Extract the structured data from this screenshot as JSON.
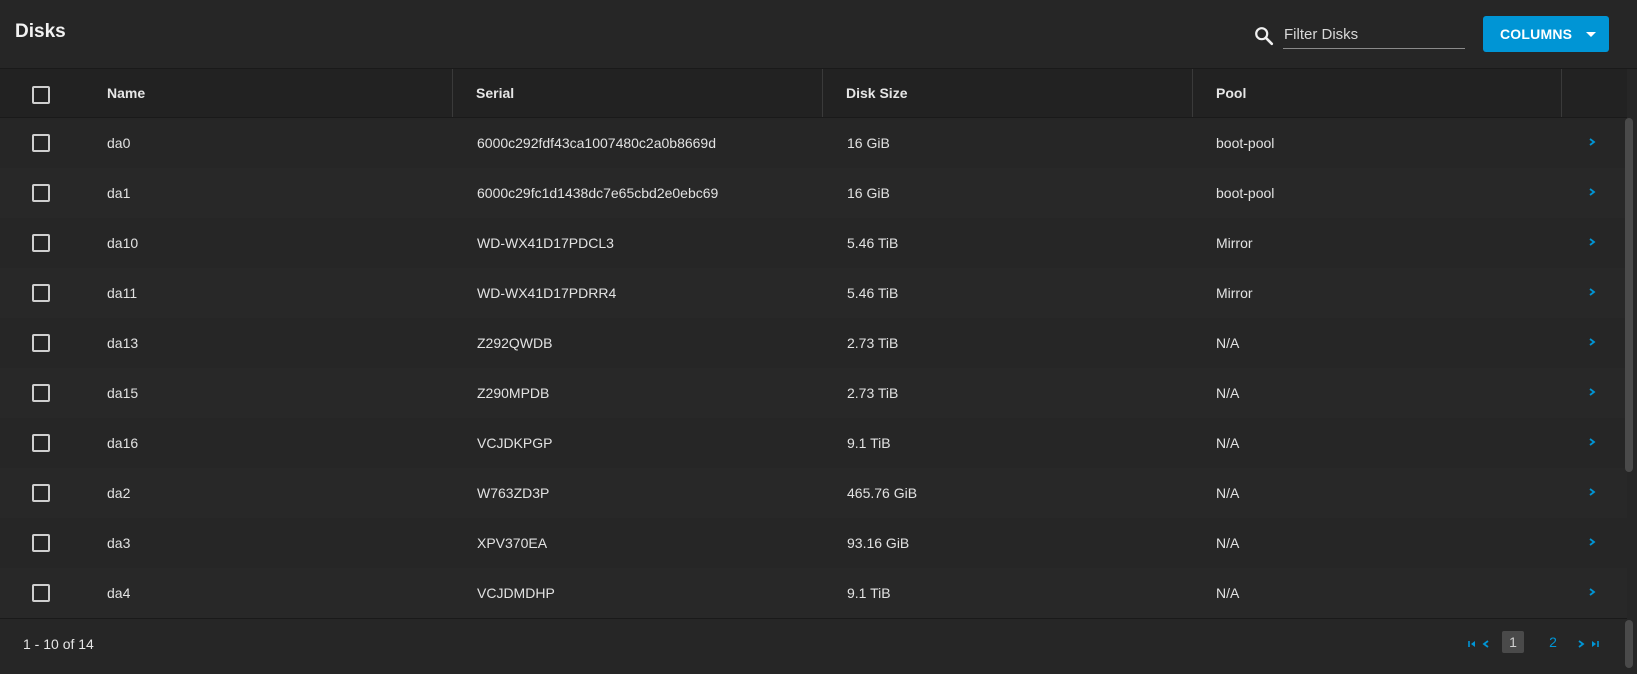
{
  "header": {
    "title": "Disks",
    "search_placeholder": "Filter Disks",
    "columns_label": "COLUMNS"
  },
  "table": {
    "columns": [
      "Name",
      "Serial",
      "Disk Size",
      "Pool"
    ],
    "rows": [
      {
        "name": "da0",
        "serial": "6000c292fdf43ca1007480c2a0b8669d",
        "size": "16 GiB",
        "pool": "boot-pool"
      },
      {
        "name": "da1",
        "serial": "6000c29fc1d1438dc7e65cbd2e0ebc69",
        "size": "16 GiB",
        "pool": "boot-pool"
      },
      {
        "name": "da10",
        "serial": "WD-WX41D17PDCL3",
        "size": "5.46 TiB",
        "pool": "Mirror"
      },
      {
        "name": "da11",
        "serial": "WD-WX41D17PDRR4",
        "size": "5.46 TiB",
        "pool": "Mirror"
      },
      {
        "name": "da13",
        "serial": "Z292QWDB",
        "size": "2.73 TiB",
        "pool": "N/A"
      },
      {
        "name": "da15",
        "serial": "Z290MPDB",
        "size": "2.73 TiB",
        "pool": "N/A"
      },
      {
        "name": "da16",
        "serial": "VCJDKPGP",
        "size": "9.1 TiB",
        "pool": "N/A"
      },
      {
        "name": "da2",
        "serial": "W763ZD3P",
        "size": "465.76 GiB",
        "pool": "N/A"
      },
      {
        "name": "da3",
        "serial": "XPV370EA",
        "size": "93.16 GiB",
        "pool": "N/A"
      },
      {
        "name": "da4",
        "serial": "VCJDMDHP",
        "size": "9.1 TiB",
        "pool": "N/A"
      }
    ]
  },
  "pagination": {
    "range_label": "1 - 10 of 14",
    "pages": [
      "1",
      "2"
    ],
    "current_page": "1"
  },
  "colors": {
    "accent": "#0095d5",
    "background": "#262626",
    "header_row": "#222222"
  }
}
